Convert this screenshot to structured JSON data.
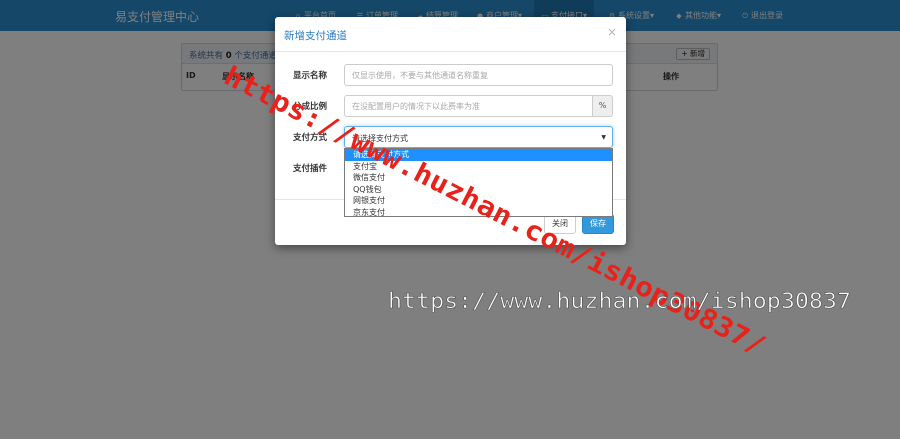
{
  "app": {
    "brand": "易支付管理中心"
  },
  "nav": {
    "items": [
      {
        "icon": "home-icon",
        "label": "平台首页"
      },
      {
        "icon": "list-icon",
        "label": "订单管理"
      },
      {
        "icon": "cloud-icon",
        "label": "结算管理"
      },
      {
        "icon": "user-icon",
        "label": "商户管理▾"
      },
      {
        "icon": "credit-card-icon",
        "label": "支付接口▾"
      },
      {
        "icon": "gear-icon",
        "label": "系统设置▾"
      },
      {
        "icon": "cube-icon",
        "label": "其他功能▾"
      },
      {
        "icon": "power-icon",
        "label": "退出登录"
      }
    ]
  },
  "panel": {
    "summary_prefix": "系统共有 ",
    "summary_count": "0",
    "summary_suffix": " 个支付通道",
    "add_label": "+ 新增",
    "headers": {
      "id": "ID",
      "name": "显示名称",
      "ops": "操作"
    }
  },
  "modal": {
    "title": "新增支付通道",
    "close_glyph": "×",
    "fields": {
      "display_name": {
        "label": "显示名称",
        "placeholder": "仅显示使用，不要与其他通道名称重复"
      },
      "rate": {
        "label": "分成比例",
        "placeholder": "在没配置用户的情况下以此费率为准",
        "unit": "%"
      },
      "pay_type": {
        "label": "支付方式",
        "selected": "请选择支付方式"
      },
      "plugin": {
        "label": "支付插件"
      }
    },
    "dropdown_options": [
      "请选择支付方式",
      "支付宝",
      "微信支付",
      "QQ钱包",
      "网银支付",
      "京东支付"
    ],
    "buttons": {
      "close": "关闭",
      "save": "保存"
    }
  },
  "watermark": {
    "diagonal": "https://www.huzhan.com/ishop30837/",
    "horizontal": "https://www.huzhan.com/ishop30837"
  },
  "colors": {
    "navbar": "#2a8fd1",
    "accent": "#2a7cc0",
    "highlight": "#1e90ff",
    "watermark_red": "#e8221b"
  }
}
